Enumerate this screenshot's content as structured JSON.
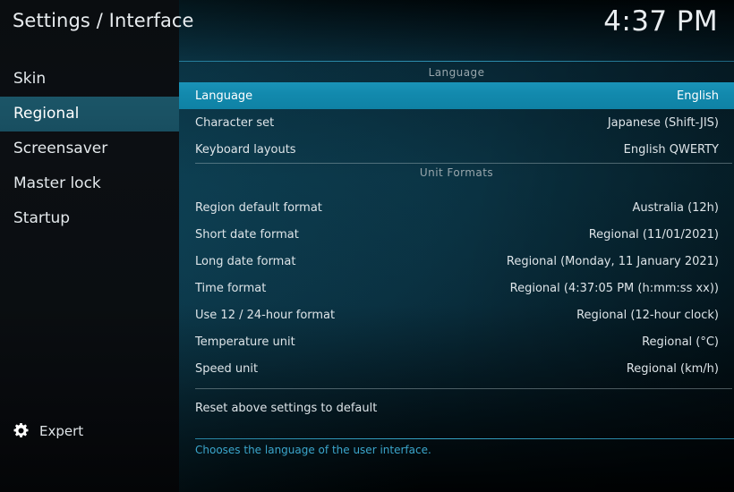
{
  "window": {
    "title": "Settings / Interface",
    "clock": "4:37 PM"
  },
  "sidebar": {
    "items": [
      {
        "label": "Skin",
        "selected": false
      },
      {
        "label": "Regional",
        "selected": true
      },
      {
        "label": "Screensaver",
        "selected": false
      },
      {
        "label": "Master lock",
        "selected": false
      },
      {
        "label": "Startup",
        "selected": false
      }
    ],
    "level_button": {
      "label": "Expert",
      "icon": "gear-icon"
    }
  },
  "main": {
    "groups": [
      {
        "heading": "Language",
        "rows": [
          {
            "label": "Language",
            "value": "English",
            "selected": true
          },
          {
            "label": "Character set",
            "value": "Japanese (Shift-JIS)",
            "selected": false
          },
          {
            "label": "Keyboard layouts",
            "value": "English QWERTY",
            "selected": false
          }
        ]
      },
      {
        "heading": "Unit Formats",
        "rows": [
          {
            "label": "Region default format",
            "value": "Australia (12h)",
            "selected": false
          },
          {
            "label": "Short date format",
            "value": "Regional (11/01/2021)",
            "selected": false
          },
          {
            "label": "Long date format",
            "value": "Regional (Monday, 11 January 2021)",
            "selected": false
          },
          {
            "label": "Time format",
            "value": "Regional (4:37:05 PM (h:mm:ss xx))",
            "selected": false
          },
          {
            "label": "Use 12 / 24-hour format",
            "value": "Regional (12-hour clock)",
            "selected": false
          },
          {
            "label": "Temperature unit",
            "value": "Regional (°C)",
            "selected": false
          },
          {
            "label": "Speed unit",
            "value": "Regional (km/h)",
            "selected": false
          }
        ]
      }
    ],
    "reset_row": {
      "label": "Reset above settings to default",
      "value": ""
    },
    "help_text": "Chooses the language of the user interface."
  },
  "colors": {
    "row_highlight": "#1289ad",
    "sidebar_highlight": "#1a5264",
    "help_text": "#3ba6cc",
    "rule": "#b0c0c6"
  }
}
